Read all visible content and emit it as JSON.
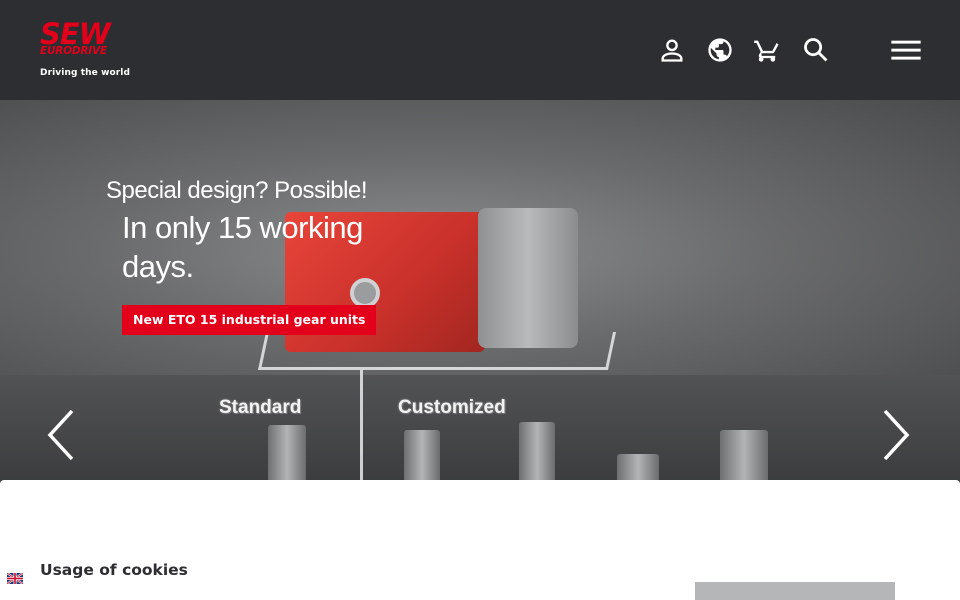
{
  "header": {
    "logo_main": "SEW",
    "logo_sub": "EURODRIVE",
    "logo_tagline": "Driving the world",
    "icons": [
      "user-icon",
      "globe-icon",
      "cart-icon",
      "search-icon",
      "menu-icon"
    ]
  },
  "hero": {
    "kicker": "Special design? Possible!",
    "title": "In only 15 working days.",
    "cta_label": "New ETO 15 industrial gear units",
    "floor_labels": [
      "Standard",
      "Customized"
    ],
    "prev_icon": "chevron-left-icon",
    "next_icon": "chevron-right-icon"
  },
  "cookie": {
    "title": "Usage of cookies",
    "button_label": "",
    "language_icon": "language-flag-icon"
  },
  "colors": {
    "brand_red": "#e2001a",
    "header_bg": "#2c2e31",
    "panel_bg": "#ffffff"
  }
}
